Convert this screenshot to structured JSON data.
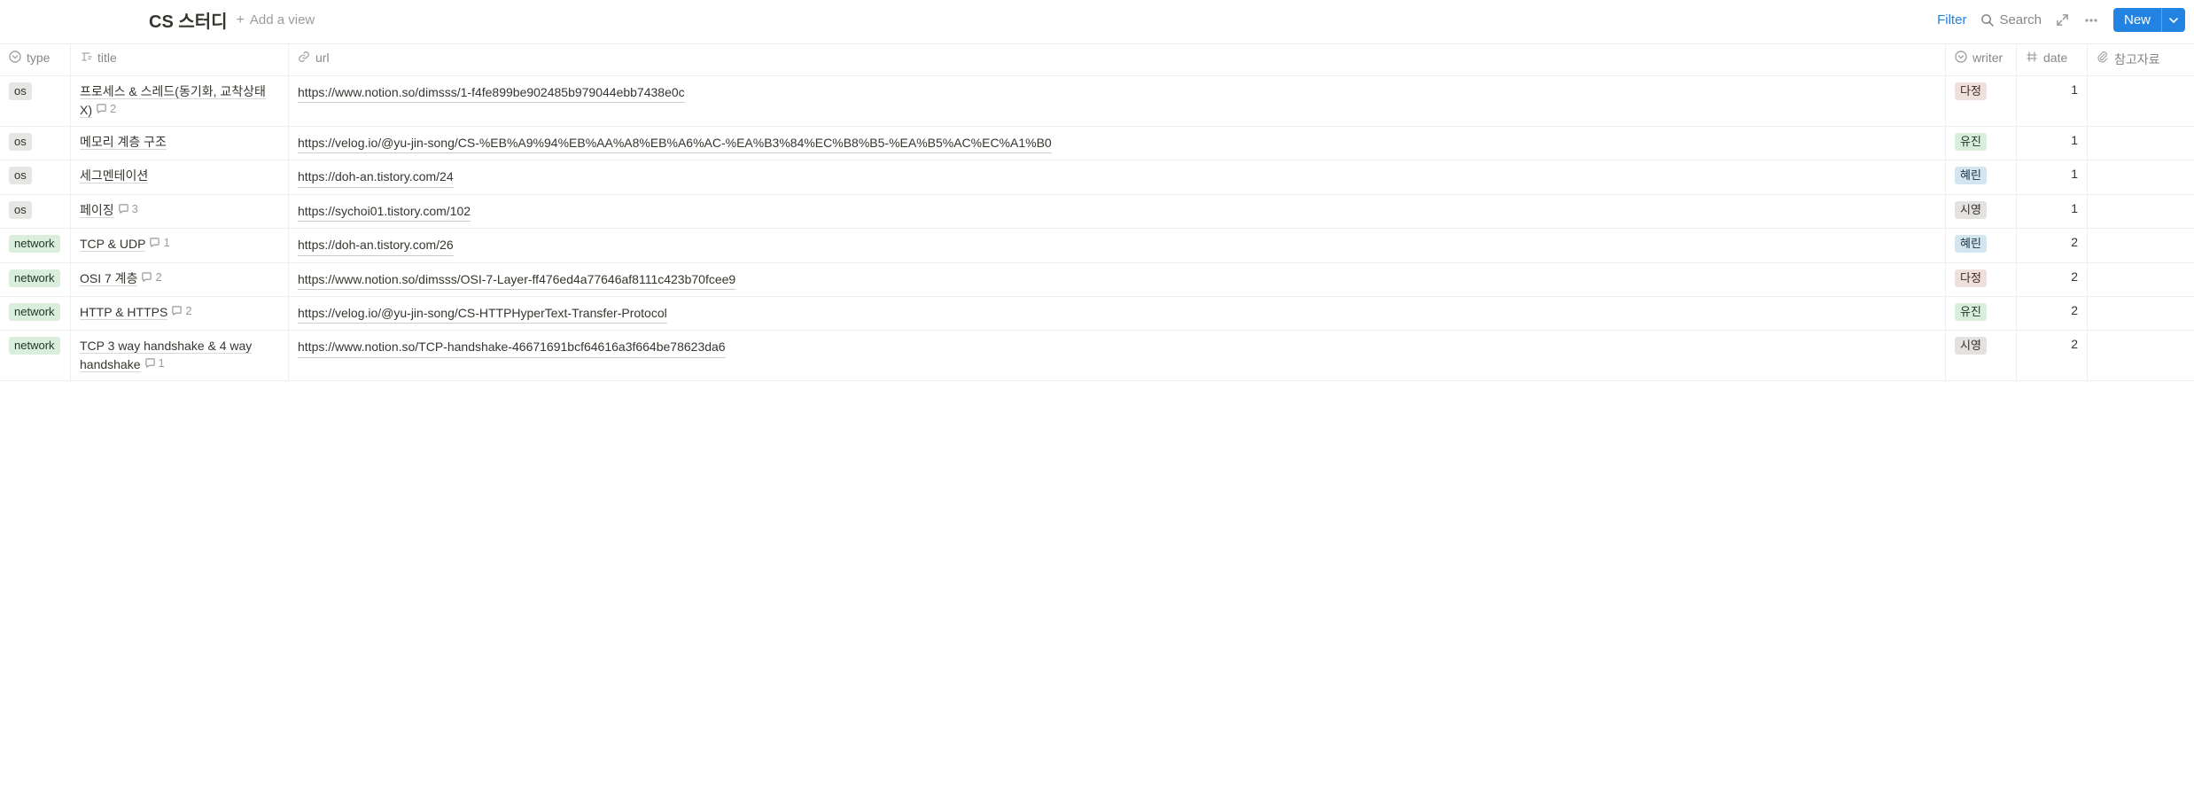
{
  "header": {
    "title": "CS 스터디",
    "add_view": "Add a view",
    "filter": "Filter",
    "search": "Search",
    "new_button": "New"
  },
  "columns": {
    "type": "type",
    "title": "title",
    "url": "url",
    "writer": "writer",
    "date": "date",
    "attach": "참고자료"
  },
  "rows": [
    {
      "type": "os",
      "type_class": "tag-os",
      "title": "프로세스 & 스레드(동기화, 교착상태 X)",
      "comments": "2",
      "url": "https://www.notion.so/dimsss/1-f4fe899be902485b979044ebb7438e0c",
      "writer": "다정",
      "writer_class": "tag-writer-dajeong",
      "date": "1"
    },
    {
      "type": "os",
      "type_class": "tag-os",
      "title": "메모리 계층 구조",
      "comments": "",
      "url": "https://velog.io/@yu-jin-song/CS-%EB%A9%94%EB%AA%A8%EB%A6%AC-%EA%B3%84%EC%B8%B5-%EA%B5%AC%EC%A1%B0",
      "writer": "유진",
      "writer_class": "tag-writer-yujin",
      "date": "1"
    },
    {
      "type": "os",
      "type_class": "tag-os",
      "title": "세그멘테이션",
      "comments": "",
      "url": "https://doh-an.tistory.com/24",
      "writer": "혜린",
      "writer_class": "tag-writer-hyerin",
      "date": "1"
    },
    {
      "type": "os",
      "type_class": "tag-os",
      "title": "페이징",
      "comments": "3",
      "url": "https://sychoi01.tistory.com/102",
      "writer": "시영",
      "writer_class": "tag-writer-siyoung",
      "date": "1"
    },
    {
      "type": "network",
      "type_class": "tag-network",
      "title": "TCP & UDP",
      "comments": "1",
      "url": "https://doh-an.tistory.com/26",
      "writer": "혜린",
      "writer_class": "tag-writer-hyerin",
      "date": "2"
    },
    {
      "type": "network",
      "type_class": "tag-network",
      "title": "OSI 7 계층",
      "comments": "2",
      "url": "https://www.notion.so/dimsss/OSI-7-Layer-ff476ed4a77646af8111c423b70fcee9",
      "writer": "다정",
      "writer_class": "tag-writer-dajeong",
      "date": "2"
    },
    {
      "type": "network",
      "type_class": "tag-network",
      "title": "HTTP & HTTPS",
      "comments": "2",
      "url": "https://velog.io/@yu-jin-song/CS-HTTPHyperText-Transfer-Protocol",
      "writer": "유진",
      "writer_class": "tag-writer-yujin",
      "date": "2"
    },
    {
      "type": "network",
      "type_class": "tag-network",
      "title": "TCP 3 way handshake & 4 way handshake",
      "comments": "1",
      "url": "https://www.notion.so/TCP-handshake-46671691bcf64616a3f664be78623da6",
      "writer": "시영",
      "writer_class": "tag-writer-siyoung",
      "date": "2"
    }
  ]
}
